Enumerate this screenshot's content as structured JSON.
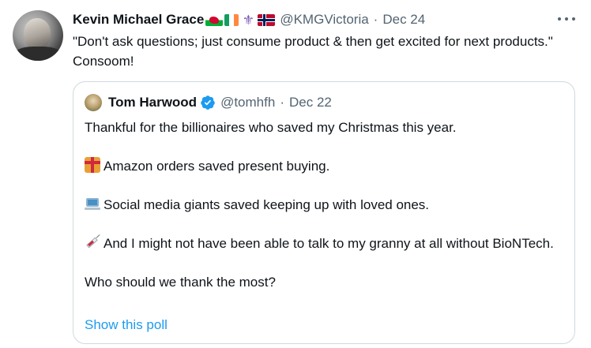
{
  "tweet": {
    "author": {
      "display_name": "Kevin Michael Grace",
      "flags": [
        "wales-flag-icon",
        "ireland-flag-icon",
        "fleur-de-lis-icon",
        "norway-flag-icon"
      ],
      "handle": "@KMGVictoria",
      "separator": "·",
      "date": "Dec 24"
    },
    "text": "\"Don't ask questions; just consume product & then get excited for next products.\" Consoom!",
    "quoted": {
      "author": {
        "display_name": "Tom Harwood",
        "verified": true,
        "handle": "@tomhfh",
        "separator": "·",
        "date": "Dec 22"
      },
      "lines": {
        "l1": "Thankful for the billionaires who saved my Christmas this year.",
        "l2": "Amazon orders saved present buying.",
        "l3": "Social media giants saved keeping up with loved ones.",
        "l4": "And I might not have been able to talk to my granny at all without BioNTech.",
        "l5": "Who should we thank the most?"
      },
      "emoji": {
        "l2": "gift-icon",
        "l3": "laptop-icon",
        "l4": "syringe-icon"
      },
      "poll_link": "Show this poll"
    }
  },
  "colors": {
    "text_primary": "#0f1419",
    "text_secondary": "#536471",
    "link": "#1d9bf0",
    "border": "#cfd9de",
    "verified": "#1d9bf0"
  }
}
